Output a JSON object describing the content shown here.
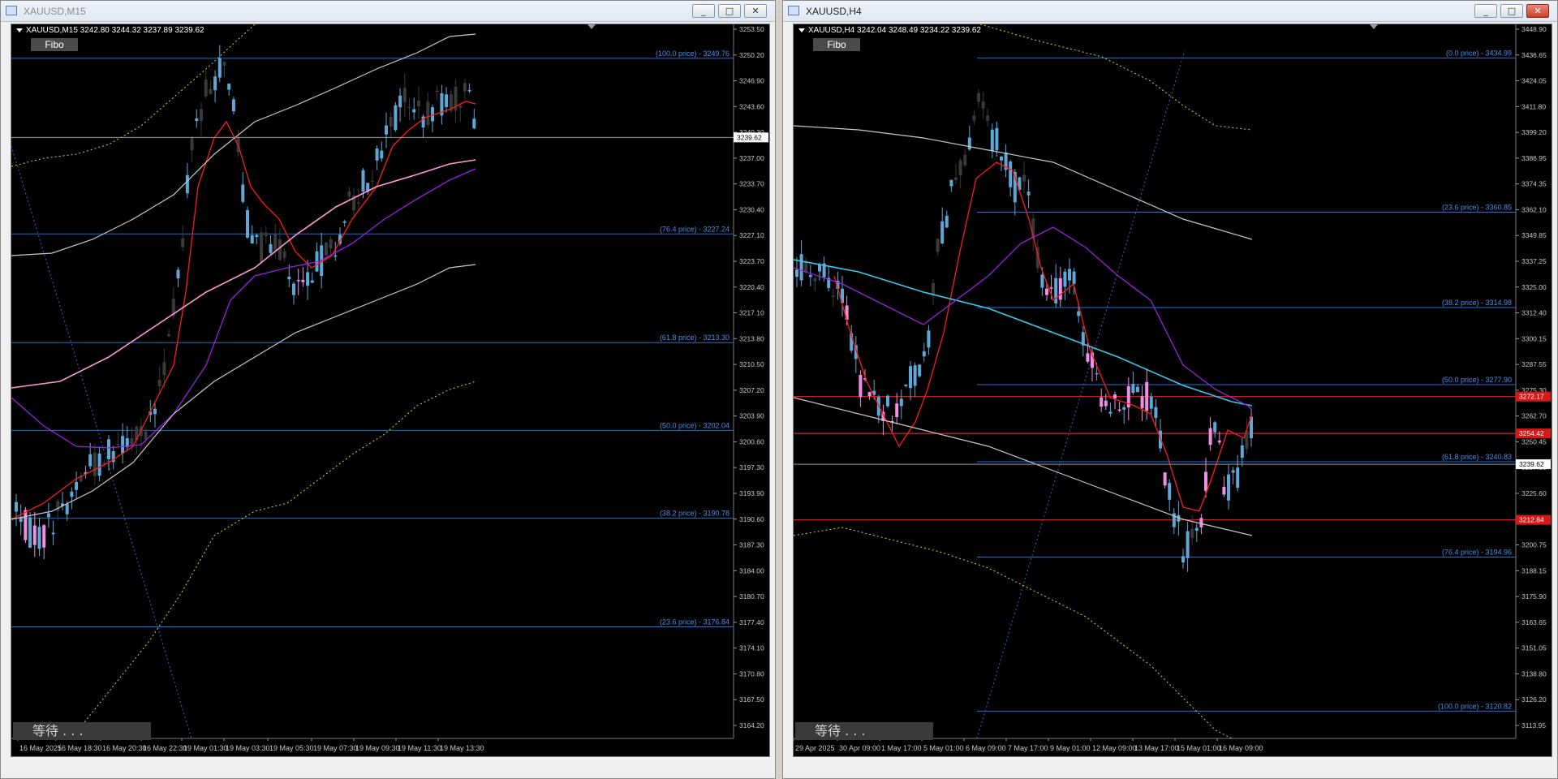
{
  "windows": [
    {
      "id": "left",
      "title": "XAUUSD,M15",
      "symbol_line": "XAUUSD,M15  3242.80 3244.32 3237.89 3239.62",
      "fibo_label": "Fibo",
      "waiting_label": "等待 . . .",
      "buttons": [
        "_",
        "□",
        "✕"
      ],
      "current_price": "3239.62",
      "price_ticks": [
        "3253.50",
        "3250.20",
        "3246.90",
        "3243.60",
        "3240.30",
        "3237.00",
        "3233.70",
        "3230.40",
        "3227.10",
        "3223.70",
        "3220.40",
        "3217.10",
        "3213.80",
        "3210.50",
        "3207.20",
        "3203.90",
        "3200.60",
        "3197.30",
        "3193.90",
        "3190.60",
        "3187.30",
        "3184.00",
        "3180.70",
        "3177.40",
        "3174.10",
        "3170.80",
        "3167.50",
        "3164.20"
      ],
      "time_ticks": [
        "16 May 2025",
        "16 May 18:30",
        "16 May 20:30",
        "16 May 22:30",
        "19 May 01:30",
        "19 May 03:30",
        "19 May 05:30",
        "19 May 07:30",
        "19 May 09:30",
        "19 May 11:30",
        "19 May 13:30"
      ],
      "fibo_levels": [
        "(100.0 price) - 3249.76",
        "(76.4 price) - 3227.24",
        "(61.8 price) - 3213.30",
        "(50.0 price) - 3202.04",
        "(38.2 price) - 3190.78",
        "(23.6 price) - 3176.84"
      ],
      "colors": {
        "bull": "#5ea8d8",
        "bear": "#3a3a3a",
        "pink": "#f08ee6",
        "fibo": "#1e6fd9",
        "ma_fast": "#ff1a1a",
        "ma_pink": "#ff9ad8",
        "ma_purple": "#9a20e0",
        "band": "#c8c8c8",
        "envelope": "#d8d820"
      }
    },
    {
      "id": "right",
      "title": "XAUUSD,H4",
      "symbol_line": "XAUUSD,H4  3242.04 3248.49 3234.22 3239.62",
      "fibo_label": "Fibo",
      "waiting_label": "等待 . . .",
      "buttons": [
        "_",
        "□",
        "✕"
      ],
      "current_price": "3239.62",
      "red_price_labels": [
        "3272.17",
        "3254.42",
        "3212.84"
      ],
      "price_ticks": [
        "3448.90",
        "3436.65",
        "3424.05",
        "3411.80",
        "3399.20",
        "3386.95",
        "3374.35",
        "3362.10",
        "3349.85",
        "3337.25",
        "3325.00",
        "3312.40",
        "3300.15",
        "3287.55",
        "3275.30",
        "3262.70",
        "3250.45",
        "3237.85",
        "3225.60",
        "3213.00",
        "3200.75",
        "3188.15",
        "3175.90",
        "3163.65",
        "3151.05",
        "3138.80",
        "3126.20",
        "3113.95"
      ],
      "time_ticks": [
        "29 Apr 2025",
        "30 Apr 09:00",
        "1 May 17:00",
        "5 May 01:00",
        "6 May 09:00",
        "7 May 17:00",
        "9 May 01:00",
        "12 May 09:00",
        "13 May 17:00",
        "15 May 01:00",
        "16 May 09:00"
      ],
      "fibo_levels": [
        "(0.0 price) - 3434.99",
        "(23.6 price) - 3360.85",
        "(38.2 price) - 3314.98",
        "(50.0 price) - 3277.90",
        "(61.8 price) - 3240.83",
        "(76.4 price) - 3194.96",
        "(100.0 price) - 3120.82"
      ],
      "colors": {
        "bull": "#5ea8d8",
        "bear": "#3a3a3a",
        "pink": "#f08ee6",
        "fibo": "#1e6fd9",
        "ma_fast": "#ff1a1a",
        "ma_cyan": "#3cc8e8",
        "ma_purple": "#9a20e0",
        "band": "#c8c8c8",
        "envelope": "#d8d820",
        "hline": "#ff1a1a"
      }
    }
  ]
}
